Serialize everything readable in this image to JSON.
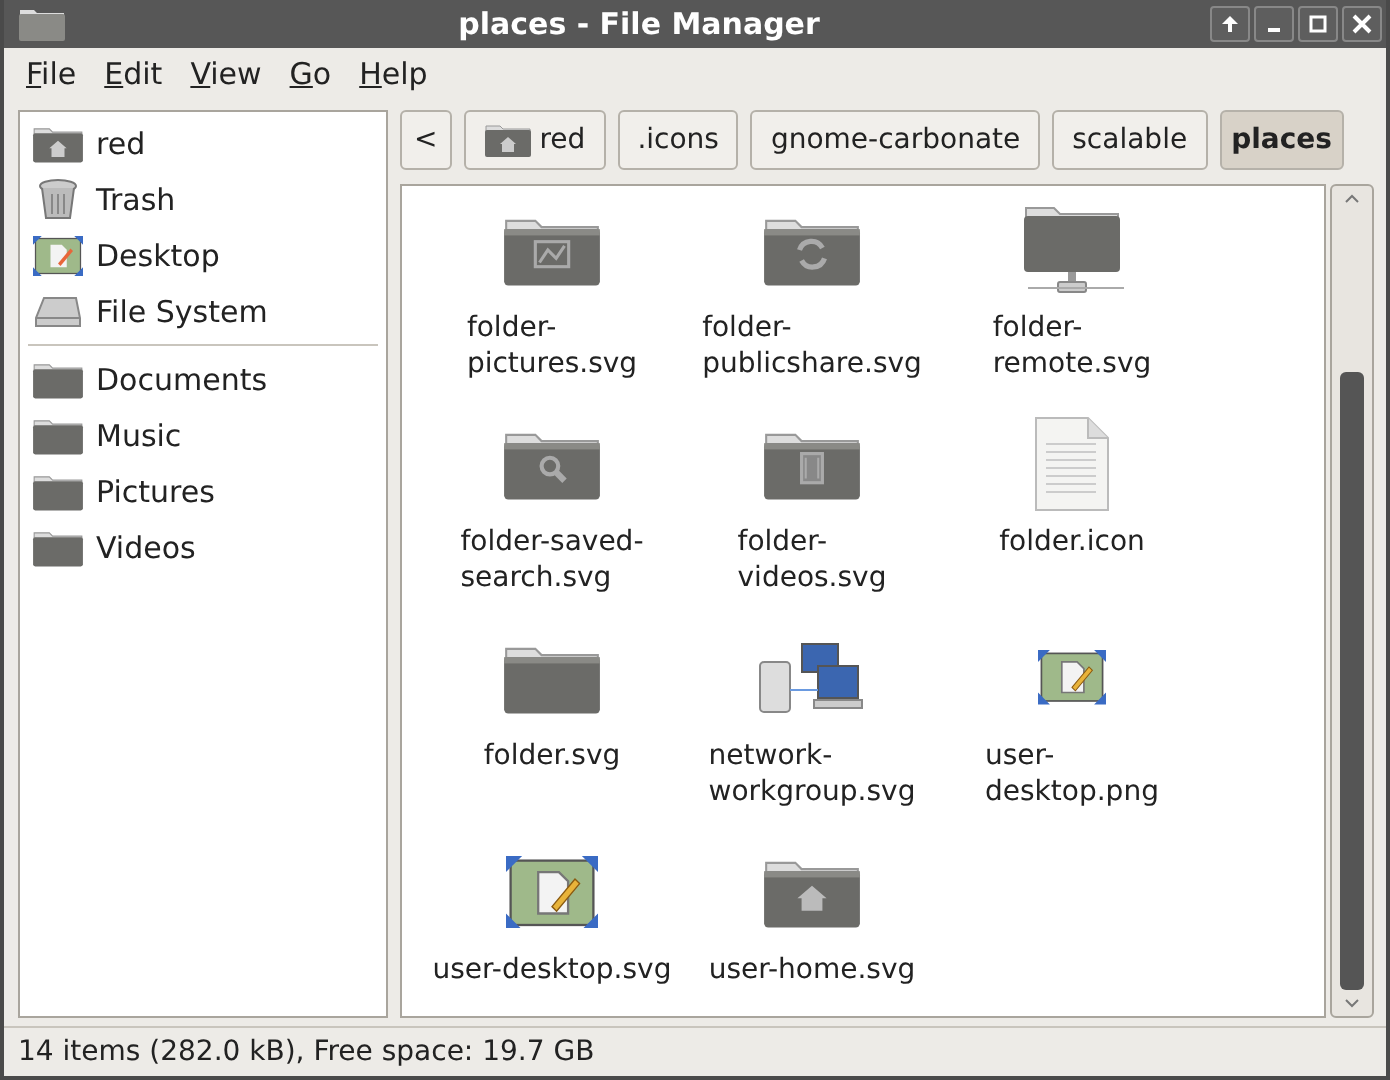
{
  "window": {
    "title": "places - File Manager"
  },
  "menu": [
    "File",
    "Edit",
    "View",
    "Go",
    "Help"
  ],
  "sidebar": {
    "items": [
      {
        "label": "red",
        "kind": "home"
      },
      {
        "label": "Trash",
        "kind": "trash"
      },
      {
        "label": "Desktop",
        "kind": "desktop"
      },
      {
        "label": "File System",
        "kind": "drive"
      },
      {
        "label": "Documents",
        "kind": "bookmark"
      },
      {
        "label": "Music",
        "kind": "bookmark"
      },
      {
        "label": "Pictures",
        "kind": "bookmark"
      },
      {
        "label": "Videos",
        "kind": "bookmark"
      }
    ]
  },
  "path_bar": {
    "back": "<",
    "crumbs": [
      {
        "label": "red",
        "home": true,
        "selected": false
      },
      {
        "label": ".icons",
        "home": false,
        "selected": false
      },
      {
        "label": "gnome-carbonate",
        "home": false,
        "selected": false
      },
      {
        "label": "scalable",
        "home": false,
        "selected": false
      },
      {
        "label": "places",
        "home": false,
        "selected": true
      }
    ]
  },
  "files": [
    {
      "lines": [
        "folder-",
        "pictures.svg"
      ],
      "kind": "pictures"
    },
    {
      "lines": [
        "folder-",
        "publicshare.svg"
      ],
      "kind": "share"
    },
    {
      "lines": [
        "folder-",
        "remote.svg"
      ],
      "kind": "remote"
    },
    {
      "lines": [
        "folder-saved-",
        "search.svg"
      ],
      "kind": "search"
    },
    {
      "lines": [
        "folder-",
        "videos.svg"
      ],
      "kind": "videos"
    },
    {
      "lines": [
        "folder.icon"
      ],
      "kind": "document"
    },
    {
      "lines": [
        "folder.svg"
      ],
      "kind": "folder"
    },
    {
      "lines": [
        "network-",
        "workgroup.svg"
      ],
      "kind": "network"
    },
    {
      "lines": [
        "user-",
        "desktop.png"
      ],
      "kind": "desktopsmall"
    },
    {
      "lines": [
        "user-desktop.svg"
      ],
      "kind": "desktop"
    },
    {
      "lines": [
        "user-home.svg"
      ],
      "kind": "home"
    }
  ],
  "status_bar": "14 items (282.0 kB), Free space: 19.7 GB"
}
